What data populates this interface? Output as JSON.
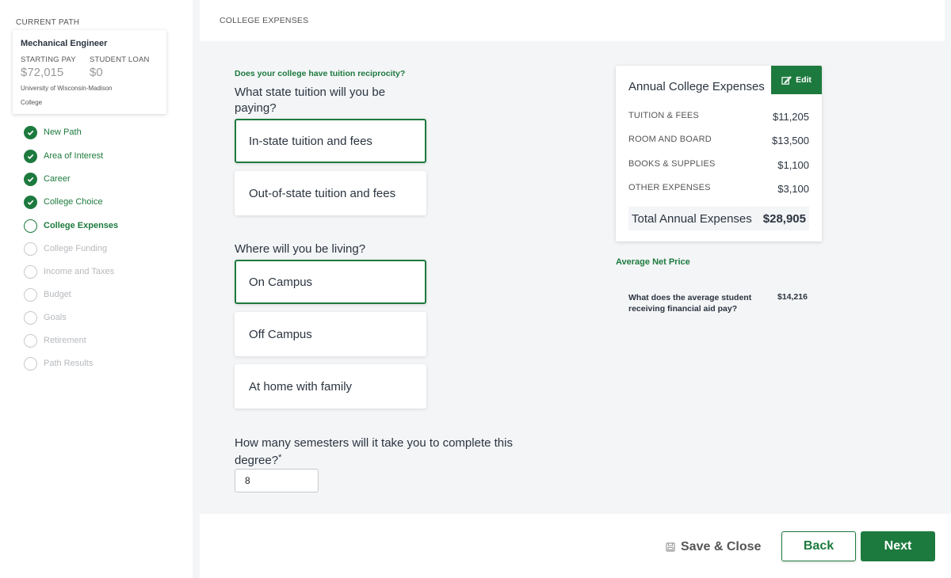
{
  "sidebar": {
    "current_path_label": "CURRENT PATH",
    "path_card": {
      "title": "Mechanical Engineer",
      "starting_pay_label": "STARTING PAY",
      "starting_pay": "$72,015",
      "student_loan_label": "STUDENT LOAN",
      "student_loan": "$0",
      "school": "University of Wisconsin-Madison",
      "school_type": "College"
    },
    "steps": [
      {
        "label": "New Path",
        "status": "done"
      },
      {
        "label": "Area of Interest",
        "status": "done"
      },
      {
        "label": "Career",
        "status": "done"
      },
      {
        "label": "College Choice",
        "status": "done"
      },
      {
        "label": "College Expenses",
        "status": "active"
      },
      {
        "label": "College Funding",
        "status": "todo"
      },
      {
        "label": "Income and Taxes",
        "status": "todo"
      },
      {
        "label": "Budget",
        "status": "todo"
      },
      {
        "label": "Goals",
        "status": "todo"
      },
      {
        "label": "Retirement",
        "status": "todo"
      },
      {
        "label": "Path Results",
        "status": "todo"
      }
    ]
  },
  "header": {
    "breadcrumb": "COLLEGE EXPENSES"
  },
  "form": {
    "reciprocity_link": "Does your college have tuition reciprocity?",
    "tuition_question": "What state tuition will you be paying?",
    "tuition_options": [
      "In-state tuition and fees",
      "Out-of-state tuition and fees"
    ],
    "tuition_selected": 0,
    "living_question": "Where will you be living?",
    "living_options": [
      "On Campus",
      "Off Campus",
      "At home with family"
    ],
    "living_selected": 0,
    "semesters_question": "How many semesters will it take you to complete this degree?",
    "semesters_required_mark": "*",
    "semesters_value": "8"
  },
  "expenses": {
    "title": "Annual College Expenses",
    "edit_label": "Edit",
    "rows": [
      {
        "label": "TUITION & FEES",
        "value": "$11,205"
      },
      {
        "label": "ROOM AND BOARD",
        "value": "$13,500"
      },
      {
        "label": "BOOKS & SUPPLIES",
        "value": "$1,100"
      },
      {
        "label": "OTHER EXPENSES",
        "value": "$3,100"
      }
    ],
    "total_label": "Total Annual Expenses",
    "total_value": "$28,905"
  },
  "net_price": {
    "title": "Average Net Price",
    "question": "What does the average student receiving financial aid pay?",
    "value": "$14,216"
  },
  "footer": {
    "save_close_label": "Save & Close",
    "back_label": "Back",
    "next_label": "Next"
  },
  "colors": {
    "accent": "#1d7a3e",
    "background": "#f4f5f7"
  }
}
